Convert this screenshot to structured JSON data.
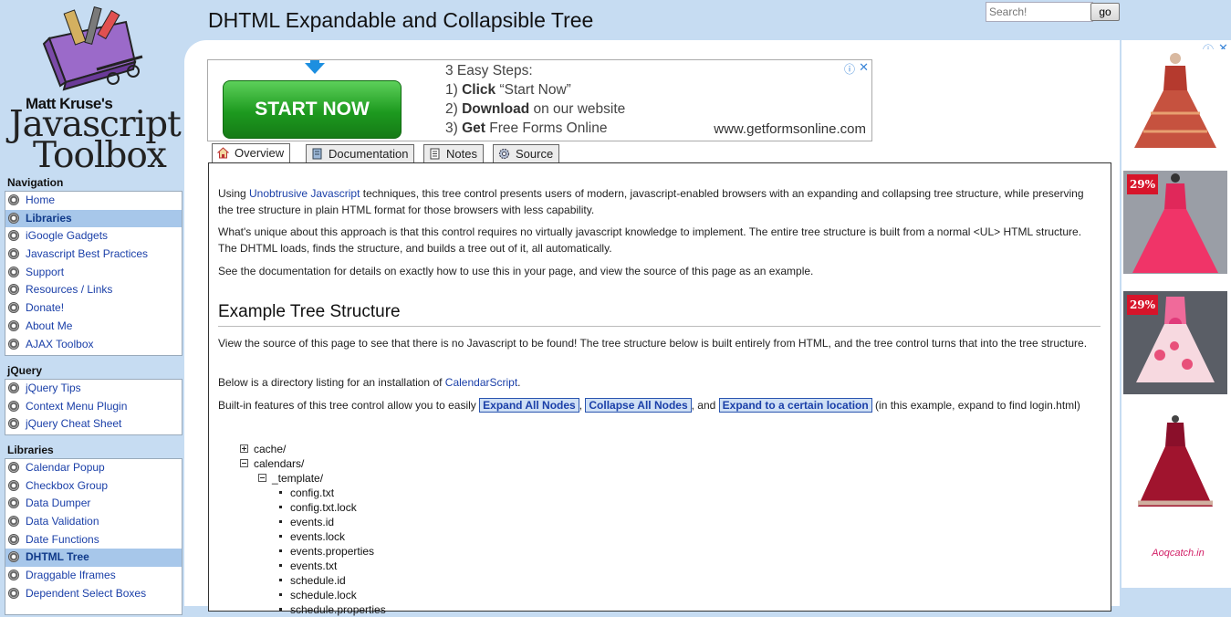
{
  "header": {
    "title": "DHTML Expandable and Collapsible Tree",
    "search_placeholder": "Search!",
    "go_label": "go"
  },
  "logo": {
    "line1": "Matt Kruse's",
    "line2": "Javascript",
    "line3": "Toolbox"
  },
  "sidebar": {
    "sections": [
      {
        "title": "Navigation",
        "items": [
          {
            "label": "Home",
            "selected": false
          },
          {
            "label": "Libraries",
            "selected": true
          },
          {
            "label": "iGoogle Gadgets",
            "selected": false
          },
          {
            "label": "Javascript Best Practices",
            "selected": false
          },
          {
            "label": "Support",
            "selected": false
          },
          {
            "label": "Resources / Links",
            "selected": false
          },
          {
            "label": "Donate!",
            "selected": false
          },
          {
            "label": "About Me",
            "selected": false
          },
          {
            "label": "AJAX Toolbox",
            "selected": false
          }
        ]
      },
      {
        "title": "jQuery",
        "items": [
          {
            "label": "jQuery Tips",
            "selected": false
          },
          {
            "label": "Context Menu Plugin",
            "selected": false
          },
          {
            "label": "jQuery Cheat Sheet",
            "selected": false
          }
        ]
      },
      {
        "title": "Libraries",
        "items": [
          {
            "label": "Calendar Popup",
            "selected": false
          },
          {
            "label": "Checkbox Group",
            "selected": false
          },
          {
            "label": "Data Dumper",
            "selected": false
          },
          {
            "label": "Data Validation",
            "selected": false
          },
          {
            "label": "Date Functions",
            "selected": false
          },
          {
            "label": "DHTML Tree",
            "selected": true
          },
          {
            "label": "Draggable Iframes",
            "selected": false
          },
          {
            "label": "Dependent Select Boxes",
            "selected": false
          }
        ]
      }
    ]
  },
  "ad_banner": {
    "cta": "START NOW",
    "heading": "3 Easy Steps:",
    "step1_num": "1)",
    "step1_bold": "Click",
    "step1_rest": " “Start Now”",
    "step2_num": "2)",
    "step2_bold": "Download",
    "step2_rest": " on our website",
    "step3_num": "3)",
    "step3_bold": "Get",
    "step3_rest": " Free Forms Online",
    "site": "www.getformsonline.com",
    "info_icon": "ⓘ",
    "close_icon": "✕"
  },
  "tabs": [
    {
      "label": "Overview",
      "icon": "home-icon",
      "active": true
    },
    {
      "label": "Documentation",
      "icon": "book-icon",
      "active": false
    },
    {
      "label": "Notes",
      "icon": "notes-icon",
      "active": false
    },
    {
      "label": "Source",
      "icon": "gear-icon",
      "active": false
    }
  ],
  "content": {
    "p1_pre": "Using ",
    "p1_link": "Unobtrusive Javascript",
    "p1_post": " techniques, this tree control presents users of modern, javascript-enabled browsers with an expanding and collapsing tree structure, while preserving the tree structure in plain HTML format for those browsers with less capability.",
    "p2": "What's unique about this approach is that this control requires no virtually javascript knowledge to implement. The entire tree structure is built from a normal <UL> HTML structure. The DHTML loads, finds the structure, and builds a tree out of it, all automatically.",
    "p3": "See the documentation for details on exactly how to use this in your page, and view the source of this page as an example.",
    "section_title": "Example Tree Structure",
    "p4": "View the source of this page to see that there is no Javascript to be found! The tree structure below is built entirely from HTML, and the tree control turns that into the tree structure.",
    "p5_pre": "Below is a directory listing for an installation of ",
    "p5_link": "CalendarScript",
    "p5_post": ".",
    "p6_pre": "Built-in features of this tree control allow you to easily ",
    "expand_all": "Expand All Nodes",
    "p6_sep1": ", ",
    "collapse_all": "Collapse All Nodes",
    "p6_sep2": ", and ",
    "expand_to": "Expand to a certain location",
    "p6_post": " (in this example, expand to find login.html)"
  },
  "tree": [
    {
      "label": "cache/",
      "type": "plus",
      "depth": 0
    },
    {
      "label": "calendars/",
      "type": "minus",
      "depth": 0
    },
    {
      "label": "_template/",
      "type": "minus",
      "depth": 1
    },
    {
      "label": "config.txt",
      "type": "leaf",
      "depth": 2
    },
    {
      "label": "config.txt.lock",
      "type": "leaf",
      "depth": 2
    },
    {
      "label": "events.id",
      "type": "leaf",
      "depth": 2
    },
    {
      "label": "events.lock",
      "type": "leaf",
      "depth": 2
    },
    {
      "label": "events.properties",
      "type": "leaf",
      "depth": 2
    },
    {
      "label": "events.txt",
      "type": "leaf",
      "depth": 2
    },
    {
      "label": "schedule.id",
      "type": "leaf",
      "depth": 2
    },
    {
      "label": "schedule.lock",
      "type": "leaf",
      "depth": 2
    },
    {
      "label": "schedule.properties",
      "type": "leaf",
      "depth": 2
    }
  ],
  "right_ad": {
    "info_icon": "ⓘ",
    "close_icon": "✕",
    "discount_1": "29%",
    "discount_2": "29%",
    "brand": "Aoqcatch.in"
  }
}
